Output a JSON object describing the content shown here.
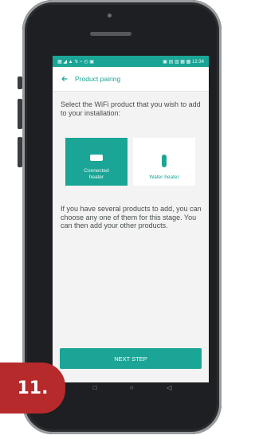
{
  "status_bar": {
    "left": "▦ ◢ ▲ ↯ ⋆ ◴ ▣",
    "right": "▣ ▤ ▥ ▦ ▩ 12:34"
  },
  "app_bar": {
    "back_icon": "arrow-left-icon",
    "title": "Product pairing"
  },
  "intro": "Select the WiFi product that you wish to add to your installation:",
  "products": [
    {
      "label": "Connected heater",
      "icon": "heater-icon",
      "selected": true
    },
    {
      "label": "Water heater",
      "icon": "water-heater-icon",
      "selected": false
    }
  ],
  "description": "If you have several products to add, you can choose any one of them for this stage. You can then add your other products.",
  "next_button": "NEXT STEP",
  "nav": {
    "recent": "□",
    "home": "○",
    "back": "◁"
  },
  "step_badge": "11.",
  "colors": {
    "accent": "#1aa596",
    "badge": "#b62a2c",
    "phone_body": "#1d1f22"
  }
}
